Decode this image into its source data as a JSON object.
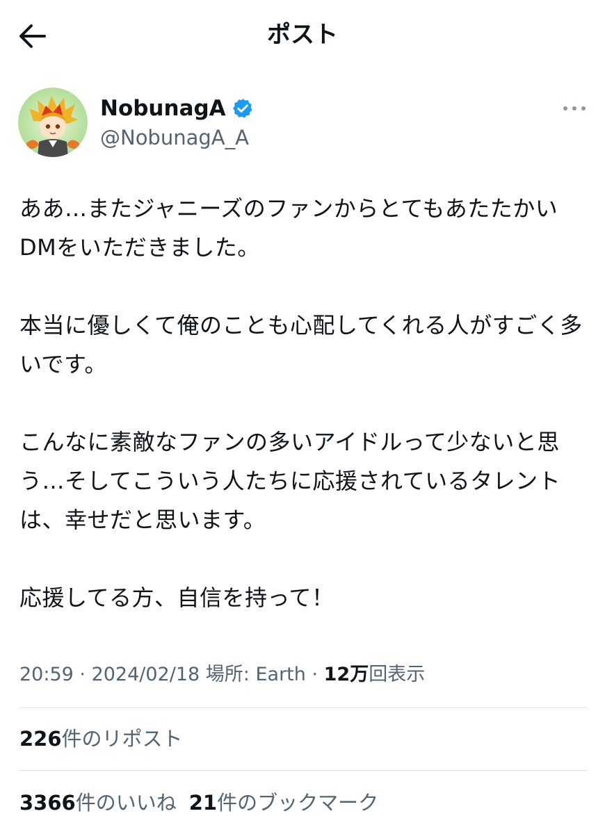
{
  "header": {
    "title": "ポスト"
  },
  "author": {
    "display_name": "NobunagA",
    "handle": "@NobunagA_A"
  },
  "tweet": {
    "paragraphs": [
      "ああ…またジャニーズのファンからとてもあたたかいDMをいただきました。",
      "本当に優しくて俺のことも心配してくれる人がすごく多いです。",
      "こんなに素敵なファンの多いアイドルって少ないと思う…そしてこういう人たちに応援されているタレントは、幸せだと思います。",
      "応援してる方、自信を持って！"
    ]
  },
  "meta": {
    "time": "20:59",
    "separator1": " · ",
    "date": "2024/02/18",
    "location_label": "場所: ",
    "location": "Earth",
    "separator2": " · ",
    "views_count": "12万",
    "views_label": "回表示"
  },
  "stats": {
    "reposts_count": "226",
    "reposts_label": "件のリポスト",
    "likes_count": "3366",
    "likes_label": "件のいいね",
    "bookmarks_count": "21",
    "bookmarks_label": "件のブックマーク"
  },
  "colors": {
    "text": "#0f1419",
    "secondary": "#536471",
    "verified": "#1d9bf0",
    "divider": "#e1e5e8"
  }
}
